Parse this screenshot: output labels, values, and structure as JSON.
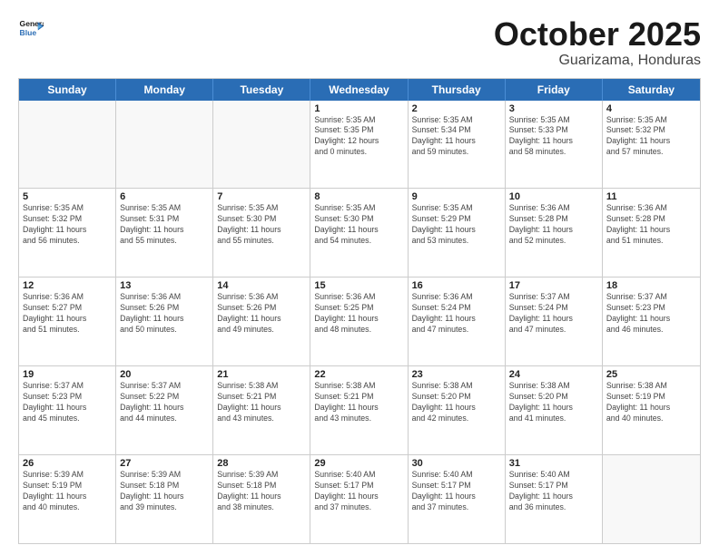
{
  "logo": {
    "line1": "General",
    "line2": "Blue"
  },
  "title": "October 2025",
  "subtitle": "Guarizama, Honduras",
  "header_days": [
    "Sunday",
    "Monday",
    "Tuesday",
    "Wednesday",
    "Thursday",
    "Friday",
    "Saturday"
  ],
  "weeks": [
    [
      {
        "day": "",
        "info": "",
        "empty": true
      },
      {
        "day": "",
        "info": "",
        "empty": true
      },
      {
        "day": "",
        "info": "",
        "empty": true
      },
      {
        "day": "1",
        "info": "Sunrise: 5:35 AM\nSunset: 5:35 PM\nDaylight: 12 hours\nand 0 minutes."
      },
      {
        "day": "2",
        "info": "Sunrise: 5:35 AM\nSunset: 5:34 PM\nDaylight: 11 hours\nand 59 minutes."
      },
      {
        "day": "3",
        "info": "Sunrise: 5:35 AM\nSunset: 5:33 PM\nDaylight: 11 hours\nand 58 minutes."
      },
      {
        "day": "4",
        "info": "Sunrise: 5:35 AM\nSunset: 5:32 PM\nDaylight: 11 hours\nand 57 minutes."
      }
    ],
    [
      {
        "day": "5",
        "info": "Sunrise: 5:35 AM\nSunset: 5:32 PM\nDaylight: 11 hours\nand 56 minutes."
      },
      {
        "day": "6",
        "info": "Sunrise: 5:35 AM\nSunset: 5:31 PM\nDaylight: 11 hours\nand 55 minutes."
      },
      {
        "day": "7",
        "info": "Sunrise: 5:35 AM\nSunset: 5:30 PM\nDaylight: 11 hours\nand 55 minutes."
      },
      {
        "day": "8",
        "info": "Sunrise: 5:35 AM\nSunset: 5:30 PM\nDaylight: 11 hours\nand 54 minutes."
      },
      {
        "day": "9",
        "info": "Sunrise: 5:35 AM\nSunset: 5:29 PM\nDaylight: 11 hours\nand 53 minutes."
      },
      {
        "day": "10",
        "info": "Sunrise: 5:36 AM\nSunset: 5:28 PM\nDaylight: 11 hours\nand 52 minutes."
      },
      {
        "day": "11",
        "info": "Sunrise: 5:36 AM\nSunset: 5:28 PM\nDaylight: 11 hours\nand 51 minutes."
      }
    ],
    [
      {
        "day": "12",
        "info": "Sunrise: 5:36 AM\nSunset: 5:27 PM\nDaylight: 11 hours\nand 51 minutes."
      },
      {
        "day": "13",
        "info": "Sunrise: 5:36 AM\nSunset: 5:26 PM\nDaylight: 11 hours\nand 50 minutes."
      },
      {
        "day": "14",
        "info": "Sunrise: 5:36 AM\nSunset: 5:26 PM\nDaylight: 11 hours\nand 49 minutes."
      },
      {
        "day": "15",
        "info": "Sunrise: 5:36 AM\nSunset: 5:25 PM\nDaylight: 11 hours\nand 48 minutes."
      },
      {
        "day": "16",
        "info": "Sunrise: 5:36 AM\nSunset: 5:24 PM\nDaylight: 11 hours\nand 47 minutes."
      },
      {
        "day": "17",
        "info": "Sunrise: 5:37 AM\nSunset: 5:24 PM\nDaylight: 11 hours\nand 47 minutes."
      },
      {
        "day": "18",
        "info": "Sunrise: 5:37 AM\nSunset: 5:23 PM\nDaylight: 11 hours\nand 46 minutes."
      }
    ],
    [
      {
        "day": "19",
        "info": "Sunrise: 5:37 AM\nSunset: 5:23 PM\nDaylight: 11 hours\nand 45 minutes."
      },
      {
        "day": "20",
        "info": "Sunrise: 5:37 AM\nSunset: 5:22 PM\nDaylight: 11 hours\nand 44 minutes."
      },
      {
        "day": "21",
        "info": "Sunrise: 5:38 AM\nSunset: 5:21 PM\nDaylight: 11 hours\nand 43 minutes."
      },
      {
        "day": "22",
        "info": "Sunrise: 5:38 AM\nSunset: 5:21 PM\nDaylight: 11 hours\nand 43 minutes."
      },
      {
        "day": "23",
        "info": "Sunrise: 5:38 AM\nSunset: 5:20 PM\nDaylight: 11 hours\nand 42 minutes."
      },
      {
        "day": "24",
        "info": "Sunrise: 5:38 AM\nSunset: 5:20 PM\nDaylight: 11 hours\nand 41 minutes."
      },
      {
        "day": "25",
        "info": "Sunrise: 5:38 AM\nSunset: 5:19 PM\nDaylight: 11 hours\nand 40 minutes."
      }
    ],
    [
      {
        "day": "26",
        "info": "Sunrise: 5:39 AM\nSunset: 5:19 PM\nDaylight: 11 hours\nand 40 minutes."
      },
      {
        "day": "27",
        "info": "Sunrise: 5:39 AM\nSunset: 5:18 PM\nDaylight: 11 hours\nand 39 minutes."
      },
      {
        "day": "28",
        "info": "Sunrise: 5:39 AM\nSunset: 5:18 PM\nDaylight: 11 hours\nand 38 minutes."
      },
      {
        "day": "29",
        "info": "Sunrise: 5:40 AM\nSunset: 5:17 PM\nDaylight: 11 hours\nand 37 minutes."
      },
      {
        "day": "30",
        "info": "Sunrise: 5:40 AM\nSunset: 5:17 PM\nDaylight: 11 hours\nand 37 minutes."
      },
      {
        "day": "31",
        "info": "Sunrise: 5:40 AM\nSunset: 5:17 PM\nDaylight: 11 hours\nand 36 minutes."
      },
      {
        "day": "",
        "info": "",
        "empty": true
      }
    ]
  ]
}
